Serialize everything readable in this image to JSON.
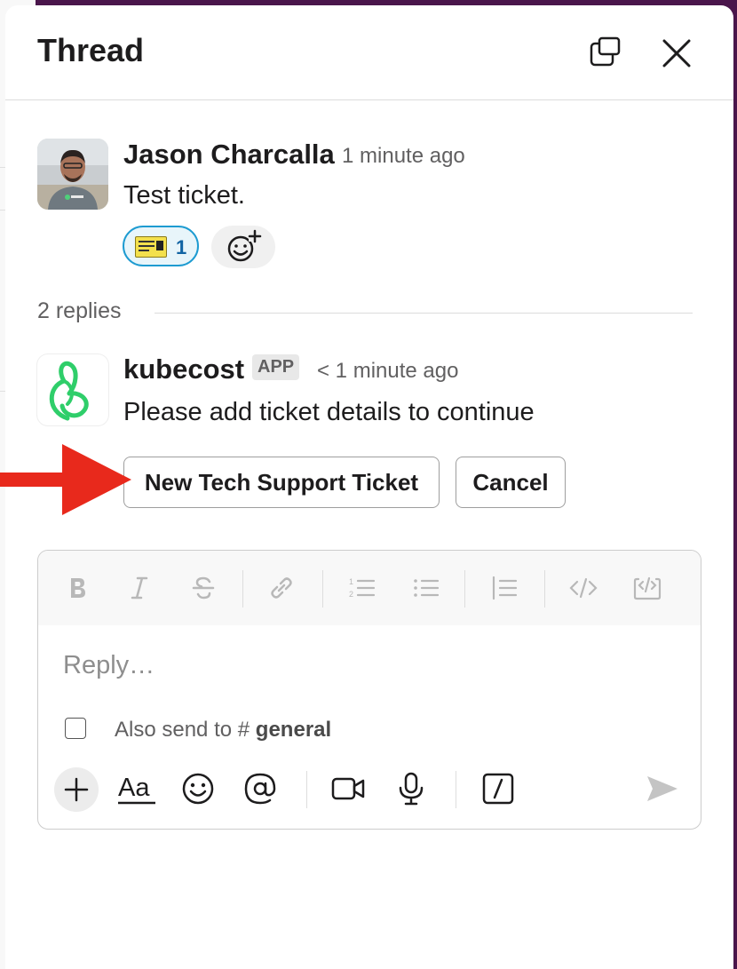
{
  "header": {
    "title": "Thread",
    "icons": [
      "pop-out-icon",
      "close-icon"
    ]
  },
  "parent_message": {
    "author": "Jason Charcalla",
    "time": "1 minute ago",
    "text": "Test ticket.",
    "reaction": {
      "emoji": "concert-ticket-emoji",
      "count": "1"
    }
  },
  "replies_label": "2 replies",
  "reply_message": {
    "author": "kubecost",
    "badge": "APP",
    "time": "< 1 minute ago",
    "text": "Please add ticket details to continue",
    "buttons": {
      "primary": "New Tech Support Ticket",
      "cancel": "Cancel"
    }
  },
  "composer": {
    "placeholder": "Reply…",
    "also_send_prefix": "Also send to",
    "channel_hash": "#",
    "channel": "general",
    "format_icons": [
      "bold-icon",
      "italic-icon",
      "strikethrough-icon",
      "link-icon",
      "ordered-list-icon",
      "bulleted-list-icon",
      "blockquote-icon",
      "code-icon",
      "code-block-icon"
    ],
    "action_icons": [
      "plus-icon",
      "text-format-icon",
      "emoji-icon",
      "mention-icon",
      "video-icon",
      "microphone-icon",
      "slash-command-icon",
      "send-icon"
    ],
    "format_label": "Aa"
  },
  "colors": {
    "accent_link": "#1264a3",
    "reaction_border": "#1d9bd1",
    "arrow": "#e8291c",
    "workspace_bg": "#4a154b"
  }
}
